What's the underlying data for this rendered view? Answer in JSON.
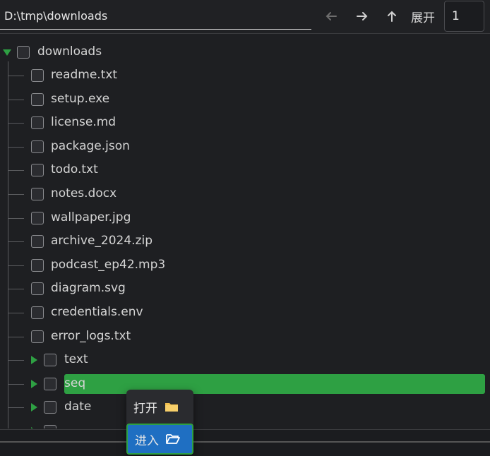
{
  "toolbar": {
    "path": "D:\\tmp\\downloads",
    "back_icon": "arrow-left",
    "forward_icon": "arrow-right",
    "up_icon": "arrow-up",
    "expand_label": "展开",
    "depth_value": "1"
  },
  "tree": {
    "root": {
      "label": "downloads"
    },
    "files": [
      "readme.txt",
      "setup.exe",
      "license.md",
      "package.json",
      "todo.txt",
      "notes.docx",
      "wallpaper.jpg",
      "archive_2024.zip",
      "podcast_ep42.mp3",
      "diagram.svg",
      "credentials.env",
      "error_logs.txt"
    ],
    "folders": [
      "text",
      "seq",
      "date"
    ],
    "selected": "seq",
    "accent": "#2ea043"
  },
  "context_menu": {
    "open_label": "打开",
    "open_icon": "folder-icon",
    "enter_label": "进入",
    "enter_icon": "folder-open-icon",
    "active_bg": "#1f6fc2"
  }
}
